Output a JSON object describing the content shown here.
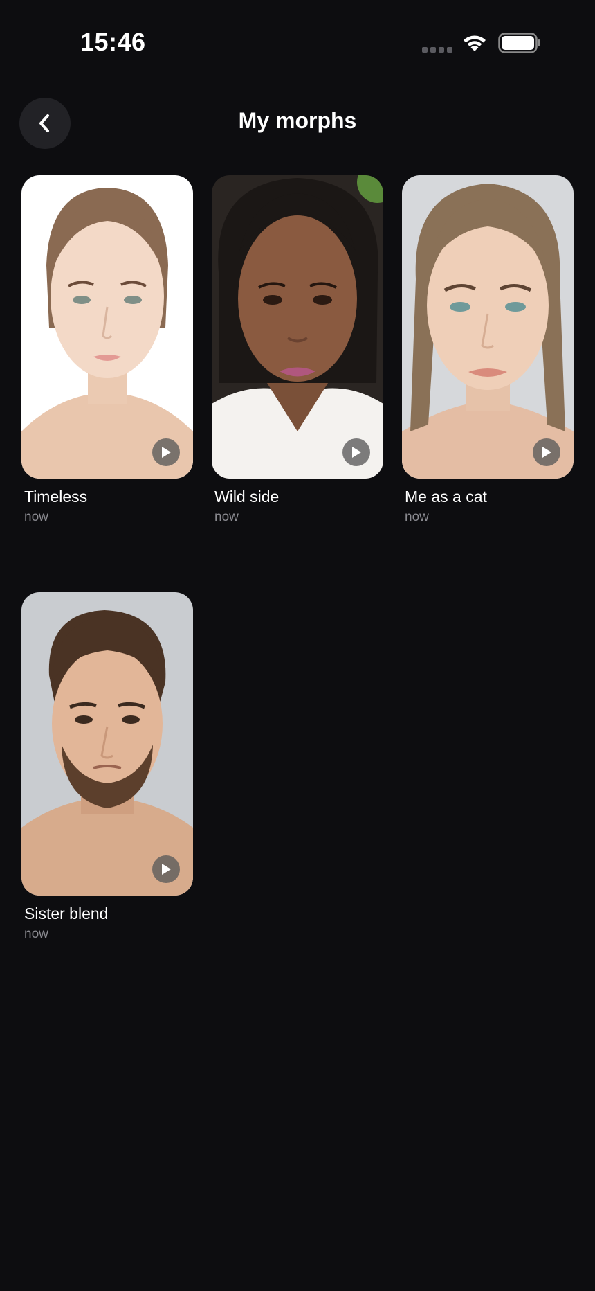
{
  "status_bar": {
    "time": "15:46"
  },
  "header": {
    "title": "My morphs",
    "back_icon": "chevron-left-icon"
  },
  "morphs": [
    {
      "title": "Timeless",
      "time": "now",
      "play_icon": "play-icon"
    },
    {
      "title": "Wild side",
      "time": "now",
      "play_icon": "play-icon"
    },
    {
      "title": "Me as a cat",
      "time": "now",
      "play_icon": "play-icon"
    },
    {
      "title": "Sister blend",
      "time": "now",
      "play_icon": "play-icon"
    }
  ],
  "colors": {
    "background": "#0d0d10",
    "back_button_bg": "#222226",
    "secondary_text": "#8a8a90"
  }
}
